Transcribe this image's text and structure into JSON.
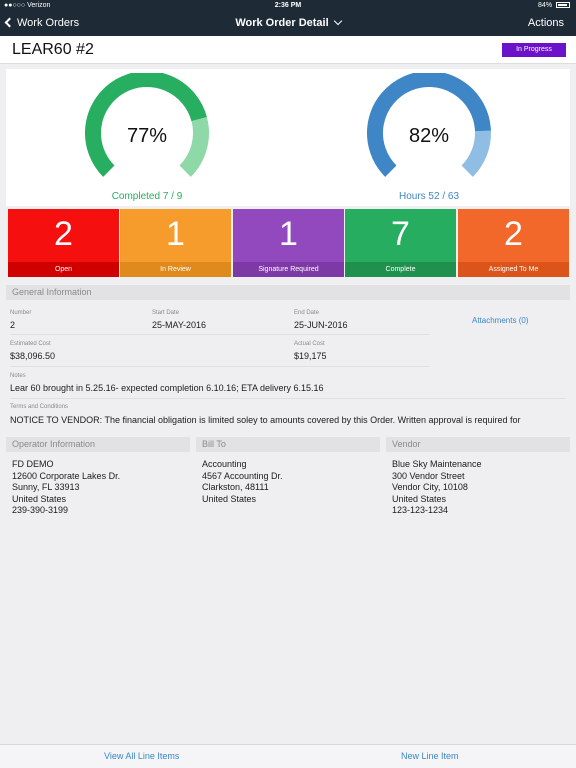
{
  "status_bar": {
    "carrier": "●●○○○ Verizon",
    "time": "2:36 PM",
    "battery": "84%"
  },
  "nav": {
    "back_label": "Work Orders",
    "title": "Work Order Detail",
    "actions_label": "Actions"
  },
  "work_order": {
    "title": "LEAR60 #2",
    "status": "In Progress"
  },
  "gauges": [
    {
      "pct_text": "77%",
      "label": "Completed 7 / 9",
      "fraction": 0.778,
      "color_main": "#27ae60",
      "color_rest": "#8fd9a8"
    },
    {
      "pct_text": "82%",
      "label": "Hours 52 / 63",
      "fraction": 0.825,
      "color_main": "#3f86c6",
      "color_rest": "#90bde3"
    }
  ],
  "tiles": [
    {
      "count": "2",
      "label": "Open",
      "color": "#f50f0f",
      "label_color": "#d10000"
    },
    {
      "count": "1",
      "label": "In Review",
      "color": "#f59c2c",
      "label_color": "#e08a1e"
    },
    {
      "count": "1",
      "label": "Signature Required",
      "color": "#9149bd",
      "label_color": "#7d3aa6"
    },
    {
      "count": "7",
      "label": "Complete",
      "color": "#27ad60",
      "label_color": "#20904e"
    },
    {
      "count": "2",
      "label": "Assigned To Me",
      "color": "#f2672a",
      "label_color": "#dc5419"
    }
  ],
  "general": {
    "section_title": "General Information",
    "number_label": "Number",
    "number": "2",
    "start_label": "Start Date",
    "start": "25-MAY-2016",
    "end_label": "End Date",
    "end": "25-JUN-2016",
    "attachments": "Attachments (0)",
    "est_label": "Estimated Cost",
    "est": "$38,096.50",
    "actual_label": "Actual Cost",
    "actual": "$19,175",
    "notes_label": "Notes",
    "notes": "Lear 60 brought in 5.25.16- expected completion 6.10.16; ETA delivery 6.15.16",
    "terms_label": "Terms and Conditions",
    "terms": "NOTICE TO VENDOR: The financial obligation is limited soley to amounts covered by this Order.  Written approval is required for"
  },
  "parties": [
    {
      "title": "Operator Information",
      "lines": [
        "FD DEMO",
        "12600 Corporate Lakes Dr.",
        "Sunny, FL 33913",
        "United States",
        "239-390-3199"
      ]
    },
    {
      "title": "Bill To",
      "lines": [
        "Accounting",
        "4567 Accounting Dr.",
        "Clarkston, 48111",
        "United States"
      ]
    },
    {
      "title": "Vendor",
      "lines": [
        "Blue Sky Maintenance",
        "300 Vendor Street",
        "Vendor City, 10108",
        "United States",
        "123-123-1234"
      ]
    }
  ],
  "bottom": {
    "view_all": "View All Line Items",
    "new_item": "New Line Item"
  }
}
